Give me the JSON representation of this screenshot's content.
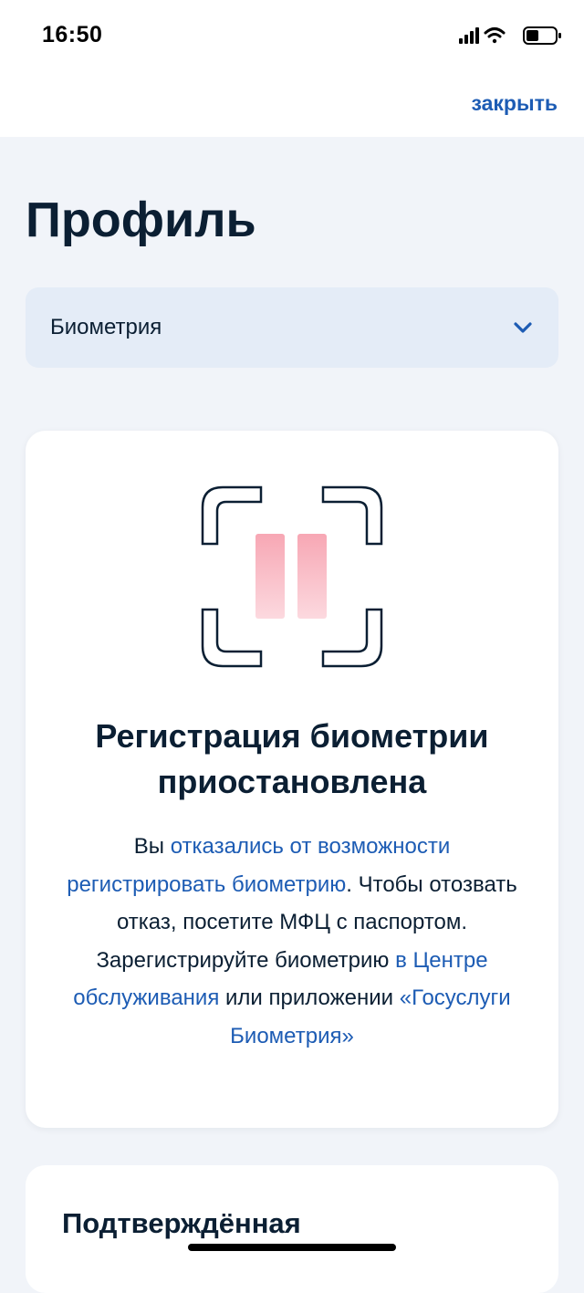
{
  "status_bar": {
    "time": "16:50"
  },
  "header": {
    "close_label": "закрыть"
  },
  "page": {
    "title": "Профиль"
  },
  "section_select": {
    "value": "Биометрия",
    "icon": "chevron-down-icon"
  },
  "biometry_card": {
    "icon": "face-scan-paused-icon",
    "title_line1": "Регистрация биометрии",
    "title_line2": "приостановлена",
    "text": {
      "part1": "Вы ",
      "link1": "отказались от возможности регистрировать биометрию",
      "part2": ". Чтобы отозвать отказ, посетите МФЦ с паспортом. Зарегистрируйте биометрию ",
      "link2": "в Центре обслуживания",
      "part3": " или приложении ",
      "link3": "«Госуслуги Биометрия»"
    }
  },
  "next_card": {
    "title": "Подтверждённая"
  },
  "colors": {
    "accent": "#1d5cb4",
    "text": "#0b1f33",
    "background": "#f1f4f9",
    "select_bg": "#e4ecf7",
    "pause_pink": "#f7a7b4"
  }
}
